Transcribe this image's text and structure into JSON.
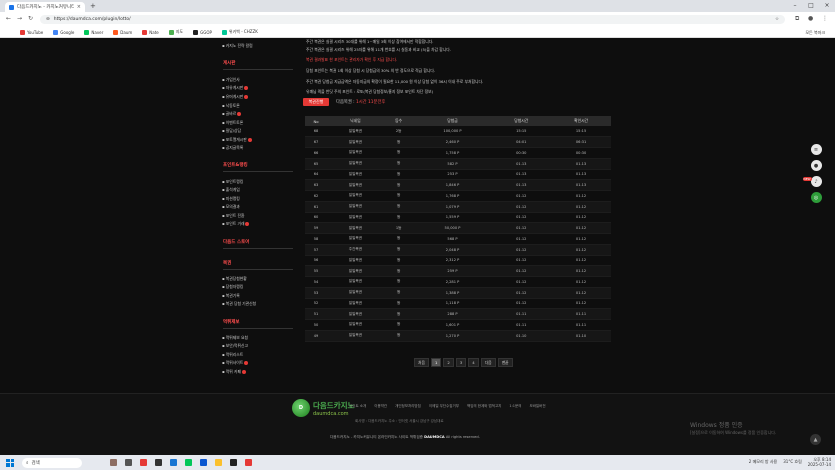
{
  "browser": {
    "tab_title": "다음드카지노 - 카지노커뮤니티",
    "url": "https://daumdca.com/plugin/lotto/",
    "bookmarks": [
      "YouTube",
      "Google",
      "Naver",
      "Daum",
      "Nate",
      "지도",
      "GGOP",
      "위키백 - CHZZK"
    ],
    "bookmarks_right": "모든 북마크"
  },
  "sidebar": {
    "top_item": "카지노 전략 칼럼",
    "sections": [
      {
        "title": "게시판",
        "items": [
          "가입인사",
          "자유게시판",
          "유머게시판",
          "낙동토론",
          "골바르",
          "이벤트토론",
          "질답/상담",
          "포토앨게시판",
          "공지글목록"
        ]
      },
      {
        "title": "포인트&랭킹",
        "items": [
          "포인트랭킹",
          "출석게임",
          "미션랭킹",
          "모의결과",
          "포인트 전환",
          "포인트 거래"
        ]
      },
      {
        "title": "다음드 스토어",
        "items": []
      },
      {
        "title": "복권",
        "items": [
          "복권당첨현황",
          "당첨자랭킹",
          "복권기록",
          "복권 당첨 기관신청"
        ]
      },
      {
        "title": "먹튀제보",
        "items": [
          "먹튀제보 요청",
          "보안/먹튀신고",
          "먹튀리스트",
          "먹튀사이트",
          "먹튀 카페"
        ]
      }
    ]
  },
  "notices": [
    "주간 복권은 실결 시리즈 30대를 위해 1~매일 3회 이상 참여에서만 적합합니다.",
    "주간 복권은 실결 시리즈 위해 25자를 위해 11개 번호를 시 실동과 비교 (5)을 차감 합니다.",
    "복권 결과발표 한 포인트는 관리자가 확인 후 지급 합니다.",
    "당첨 포인트는 복권 1회 이상 당첨 시 당첨금의 30% 의 반 정도으로 적급 합니다.",
    "주간 복권 당첨금 지급금액은 자동지급의 확정이 필요한 11,000 원 이상 당첨 없이 36시 이내 주로 부처합니다.",
    "유쾌님 퀵을 반딧 주의 포인트 : 로또(복권 당첨정보/홍지 정보 포인트 차단 정보)"
  ],
  "ongoing_button": "복권진행",
  "next_round": {
    "label": "다음복권 :",
    "value": "1시간 11분전후"
  },
  "table": {
    "headers": [
      "No",
      "닉네임",
      "등수",
      "당첨금",
      "당첨시간",
      "확인시간"
    ],
    "rows": [
      [
        "68",
        "일일복권",
        "2등",
        "100,000 P",
        "15:15",
        "15:15"
      ],
      [
        "67",
        "일일복권",
        "꽝",
        "2,460 P",
        "04:01",
        "06:31"
      ],
      [
        "66",
        "일일복권",
        "꽝",
        "1,758 P",
        "00:30",
        "00:30"
      ],
      [
        "65",
        "일일복권",
        "꽝",
        "582 P",
        "01.13",
        "01.13"
      ],
      [
        "64",
        "일일복권",
        "꽝",
        "253 P",
        "01.13",
        "01.13"
      ],
      [
        "63",
        "일일복권",
        "꽝",
        "1,846 P",
        "01.13",
        "01.13"
      ],
      [
        "62",
        "일일복권",
        "꽝",
        "1,768 P",
        "01.12",
        "01.12"
      ],
      [
        "61",
        "일일복권",
        "꽝",
        "1,079 P",
        "01.12",
        "01.12"
      ],
      [
        "60",
        "일일복권",
        "꽝",
        "1,559 P",
        "01.12",
        "01.12"
      ],
      [
        "59",
        "일일복권",
        "1등",
        "50,000 P",
        "01.12",
        "01.12"
      ],
      [
        "58",
        "일일복권",
        "꽝",
        "568 P",
        "01.12",
        "01.12"
      ],
      [
        "57",
        "주간복권",
        "꽝",
        "2,048 P",
        "01.12",
        "01.12"
      ],
      [
        "56",
        "일일복권",
        "꽝",
        "2,312 P",
        "01.12",
        "01.12"
      ],
      [
        "55",
        "일일복권",
        "꽝",
        "259 P",
        "01.12",
        "01.12"
      ],
      [
        "54",
        "일일복권",
        "꽝",
        "2,281 P",
        "01.12",
        "01.12"
      ],
      [
        "53",
        "일일복권",
        "꽝",
        "1,388 P",
        "01.12",
        "01.12"
      ],
      [
        "52",
        "일일복권",
        "꽝",
        "1,118 P",
        "01.12",
        "01.12"
      ],
      [
        "51",
        "일일복권",
        "꽝",
        "288 P",
        "01.11",
        "01.11"
      ],
      [
        "50",
        "일일복권",
        "꽝",
        "1,601 P",
        "01.11",
        "01.11"
      ],
      [
        "49",
        "일일복권",
        "꽝",
        "1,270 P",
        "01.10",
        "01.10"
      ]
    ]
  },
  "pagination": [
    "처음",
    "1",
    "2",
    "3",
    "4",
    "다음",
    "맨끝"
  ],
  "footer": {
    "links": [
      "사이트 소개",
      "이용약관",
      "개인정보처리방침",
      "이메일 무단수집거부",
      "책임의 한계와 법적고지",
      "1:1문의",
      "모바일버전"
    ],
    "info": "회사명 : 다음드카지노   주소 : 인터넷 서울시 강남구 강남대로",
    "copyright_pre": "다음드카지노 - 카지노커뮤니티 온라인카지노 사이트 먹튀검증 ",
    "copyright_brand": "DAUMDCA",
    "copyright_post": " All rights reserved.",
    "logo_main": "다음드카지노",
    "logo_sub": "daumdca.com"
  },
  "watermark": {
    "line1": "Windows 정품 인증",
    "line2": "[설정]으로 이동하여 Windows를 정품 인증합니다."
  },
  "floating": {
    "badge": "NEW"
  },
  "taskbar": {
    "search": "검색",
    "tray_text": "오후 8:14",
    "date": "2025-07-14",
    "weather": "31°C 흐림",
    "tray_label": "2 메모리 방 사용"
  }
}
